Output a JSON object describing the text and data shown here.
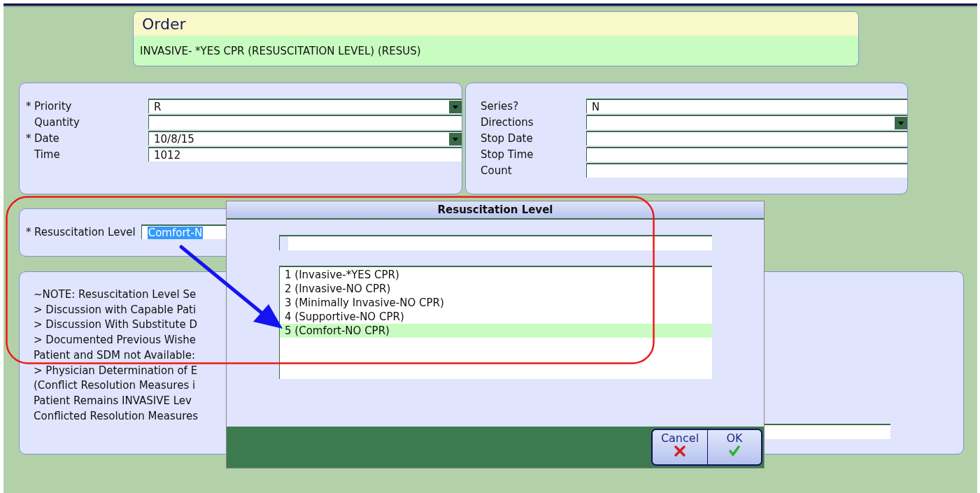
{
  "order": {
    "title": "Order",
    "description": "INVASIVE- *YES CPR (RESUSCITATION LEVEL) (RESUS)"
  },
  "left_fields": [
    {
      "mark": "*",
      "label": "Priority",
      "value": "R",
      "kind": "dropdown"
    },
    {
      "label": "Quantity",
      "kind": "text"
    },
    {
      "mark": "*",
      "label": "Date",
      "value": "10/8/15",
      "kind": "dropdown"
    },
    {
      "label": "Time",
      "value": "1012",
      "kind": "text"
    }
  ],
  "right_fields": [
    {
      "label": "Series?",
      "value": "N",
      "kind": "text"
    },
    {
      "label": "Directions",
      "kind": "dropdown"
    },
    {
      "label": "Stop Date",
      "kind": "text"
    },
    {
      "label": "Stop Time",
      "kind": "text"
    },
    {
      "label": "Count",
      "kind": "text"
    }
  ],
  "resuscitation": {
    "mark": "*",
    "label": "Resuscitation Level",
    "value": "Comfort-N"
  },
  "note_lines": [
    "~NOTE: Resuscitation Level Se",
    "> Discussion with Capable Pati",
    "> Discussion With Substitute D",
    "> Documented Previous Wishe",
    "Patient and SDM not Available:",
    "> Physician Determination of E",
    "(Conflict Resolution Measures i",
    "Patient Remains INVASIVE Lev",
    "Conflicted Resolution Measures"
  ],
  "dialog": {
    "title": "Resuscitation Level",
    "options": [
      {
        "label": "1 (Invasive-*YES CPR)",
        "selected": false
      },
      {
        "label": "2 (Invasive-NO CPR)",
        "selected": false
      },
      {
        "label": "3 (Minimally Invasive-NO CPR)",
        "selected": false
      },
      {
        "label": "4 (Supportive-NO CPR)",
        "selected": false
      },
      {
        "label": "5 (Comfort-NO CPR)",
        "selected": true
      }
    ],
    "buttons": [
      {
        "label": "Cancel",
        "kind": "cancel"
      },
      {
        "label": "OK",
        "kind": "ok"
      }
    ]
  }
}
